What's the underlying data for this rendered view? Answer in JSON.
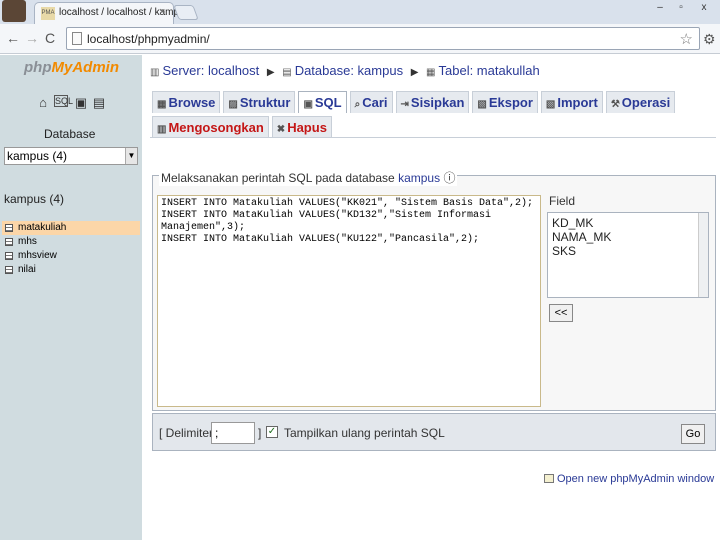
{
  "browser": {
    "tab_title": "localhost / localhost / kampus",
    "tab_close": "×",
    "favicon_text": "PMA",
    "url": "localhost/phpmyadmin/",
    "window_controls": [
      "–",
      "▫",
      "x"
    ],
    "nav": {
      "back": "←",
      "forward": "→",
      "reload": "C"
    }
  },
  "sidebar": {
    "logo_prefix": "php",
    "logo_main": "MyAdmin",
    "icons": [
      "home-icon",
      "sql-icon",
      "query-icon",
      "docs-icon",
      "help-icon"
    ],
    "database_label": "Database",
    "database_select": "kampus (4)",
    "db_heading": "kampus (4)",
    "tables": [
      {
        "label": "matakuliah",
        "active": true
      },
      {
        "label": "mhs",
        "active": false
      },
      {
        "label": "mhsview",
        "active": false
      },
      {
        "label": "nilai",
        "active": false
      }
    ]
  },
  "breadcrumb": {
    "server": "Server: localhost",
    "database": "Database: kampus",
    "table": "Tabel: matakullah"
  },
  "tabs_row1": [
    {
      "label": "Browse",
      "icon": "browse-icon",
      "active": false
    },
    {
      "label": "Struktur",
      "icon": "structure-icon",
      "active": false
    },
    {
      "label": "SQL",
      "icon": "sql-icon",
      "active": true
    },
    {
      "label": "Cari",
      "icon": "search-icon",
      "active": false
    },
    {
      "label": "Sisipkan",
      "icon": "insert-icon",
      "active": false
    },
    {
      "label": "Ekspor",
      "icon": "export-icon",
      "active": false
    },
    {
      "label": "Import",
      "icon": "import-icon",
      "active": false
    },
    {
      "label": "Operasi",
      "icon": "operations-icon",
      "active": false
    }
  ],
  "tabs_row2": [
    {
      "label": "Mengosongkan",
      "icon": "empty-icon"
    },
    {
      "label": "Hapus",
      "icon": "drop-icon"
    }
  ],
  "sql": {
    "legend_prefix": "Melaksanakan perintah SQL pada database",
    "legend_db": "kampus",
    "query": "INSERT INTO Matakuliah VALUES(\"KK021\", \"Sistem Basis Data\",2);\nINSERT INTO MataKuliah VALUES(\"KD132\",\"Sistem Informasi Manajemen\",3);\nINSERT INTO MataKuliah VALUES(\"KU122\",\"Pancasila\",2);",
    "field_label": "Field",
    "fields": [
      "KD_MK",
      "NAMA_MK",
      "SKS"
    ],
    "insert_button": "<<"
  },
  "options": {
    "delimiter_open": "[ Delimiter",
    "delimiter_value": ";",
    "delimiter_close": "]",
    "show_query_label": "Tampilkan ulang perintah SQL",
    "show_query_checked": "✓",
    "go_button": "Go"
  },
  "footer": {
    "new_window_link": "Open new phpMyAdmin window"
  },
  "colors": {
    "link": "#2a3a96",
    "sidebar_bg": "#d0dce0",
    "active_table": "#fcd6a8",
    "danger": "#c41616"
  }
}
